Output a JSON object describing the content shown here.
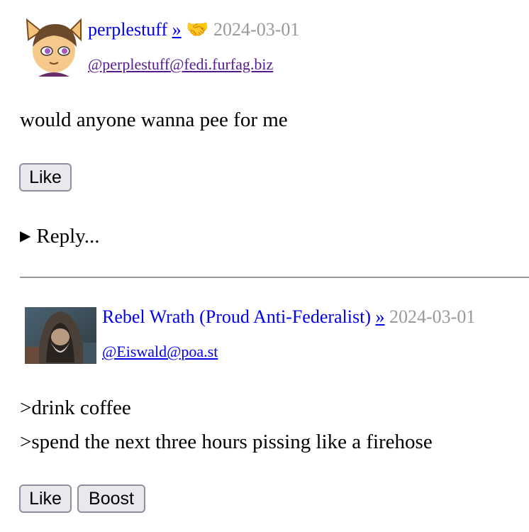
{
  "posts": [
    {
      "author": "perplestuff",
      "arrow": "»",
      "emoji": "🤝",
      "date": "2024-03-01",
      "handle": "@perplestuff@fedi.furfag.biz",
      "body": [
        "would anyone wanna pee for me"
      ],
      "buttons": {
        "like": "Like"
      },
      "reply": "Reply..."
    },
    {
      "author": "Rebel Wrath (Proud Anti-Federalist)",
      "arrow": "»",
      "date": "2024-03-01",
      "handle": "@Eiswald@poa.st",
      "body": [
        ">drink coffee",
        ">spend the next three hours pissing like a firehose"
      ],
      "buttons": {
        "like": "Like",
        "boost": "Boost"
      }
    }
  ]
}
